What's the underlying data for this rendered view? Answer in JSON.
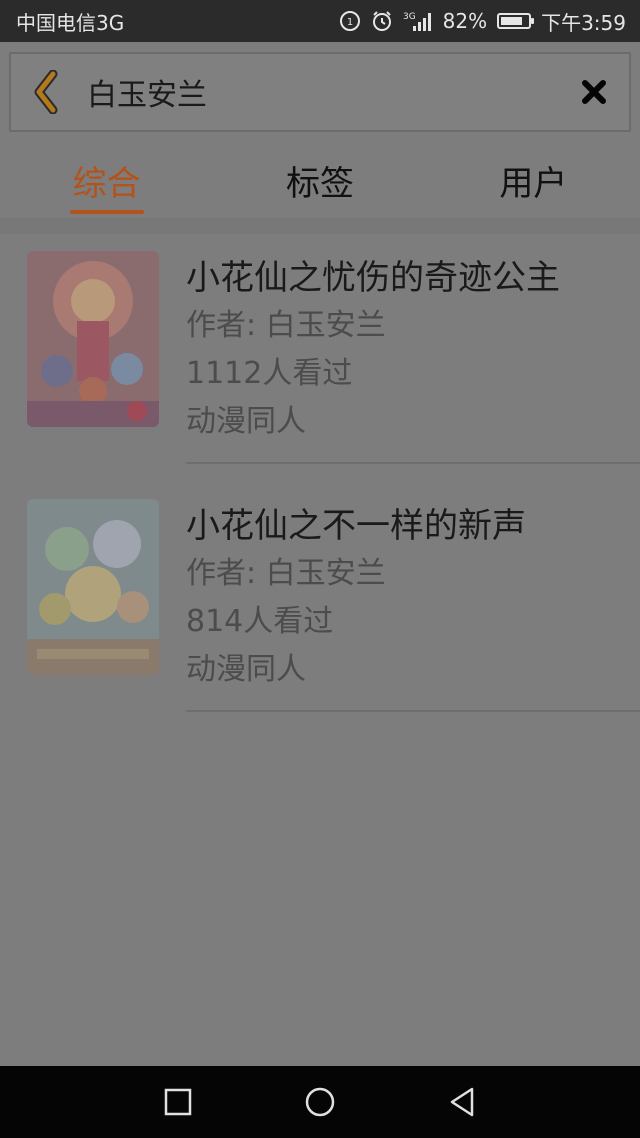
{
  "status_bar": {
    "carrier": "中国电信3G",
    "battery_percent": "82%",
    "battery_level": 0.82,
    "network": "3G",
    "time": "下午3:59",
    "icons": [
      "lte-sim-icon",
      "alarm-clock-icon",
      "signal-strength-icon",
      "battery-icon"
    ]
  },
  "search": {
    "value": "白玉安兰",
    "back_icon": "chevron-left-icon",
    "clear_icon": "close-icon",
    "accent_color": "#b3521c"
  },
  "tabs": [
    {
      "label": "综合",
      "active": true
    },
    {
      "label": "标签",
      "active": false
    },
    {
      "label": "用户",
      "active": false
    }
  ],
  "results": [
    {
      "title": "小花仙之忧伤的奇迹公主",
      "author": "作者: 白玉安兰",
      "views": "1112人看过",
      "category": "动漫同人"
    },
    {
      "title": "小花仙之不一样的新声",
      "author": "作者: 白玉安兰",
      "views": "814人看过",
      "category": "动漫同人"
    }
  ],
  "nav_bar": {
    "icons": [
      "recent-apps-icon",
      "home-icon",
      "back-icon"
    ]
  }
}
